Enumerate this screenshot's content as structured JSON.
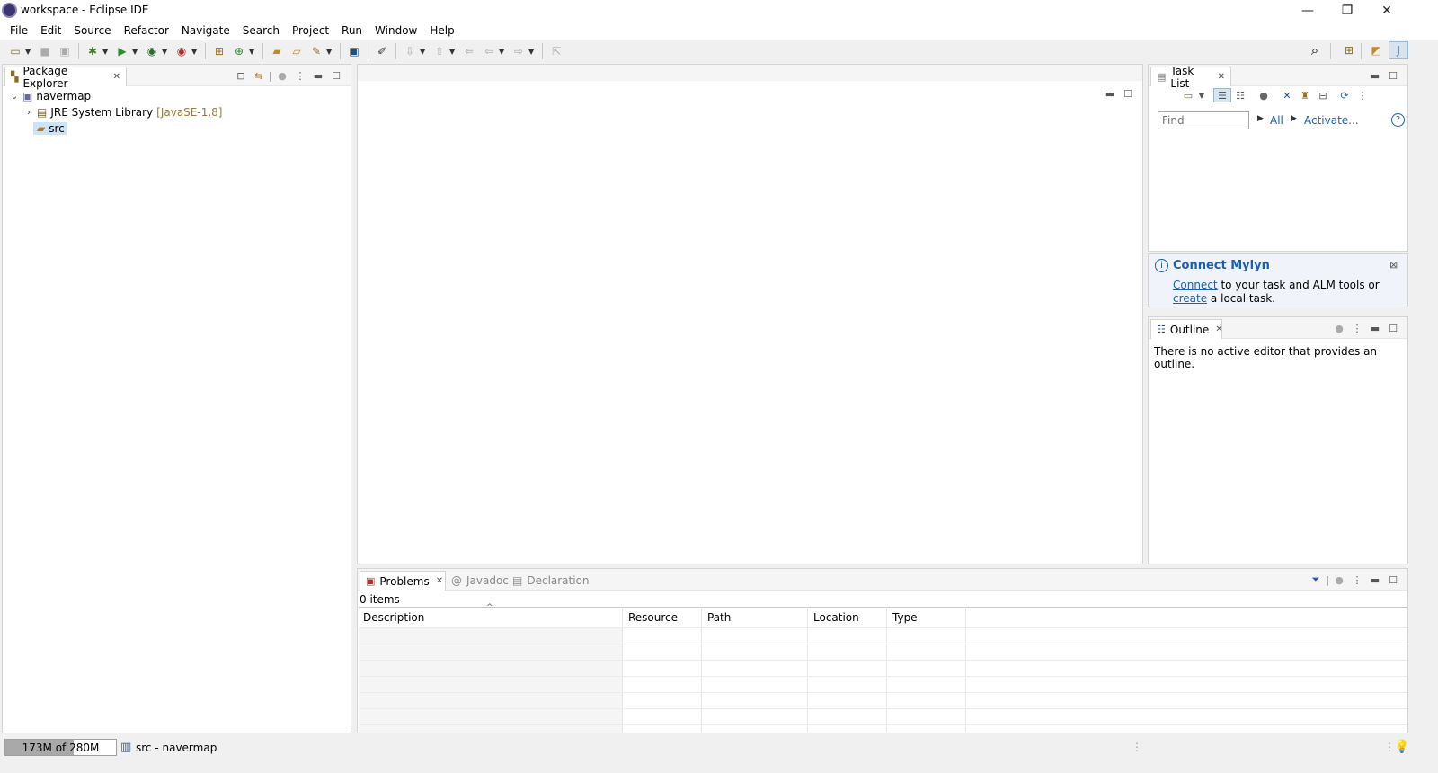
{
  "window": {
    "title": "workspace - Eclipse IDE",
    "controls": {
      "minimize": "—",
      "restore": "❐",
      "close": "✕"
    }
  },
  "menu": {
    "items": [
      {
        "label": "File"
      },
      {
        "label": "Edit"
      },
      {
        "label": "Source"
      },
      {
        "label": "Refactor"
      },
      {
        "label": "Navigate"
      },
      {
        "label": "Search"
      },
      {
        "label": "Project"
      },
      {
        "label": "Run"
      },
      {
        "label": "Window"
      },
      {
        "label": "Help"
      }
    ]
  },
  "package_explorer": {
    "tab_label": "Package Explorer",
    "tree": {
      "project": "navermap",
      "jre_label": "JRE System Library",
      "jre_decoration": "[JavaSE-1.8]",
      "src_label": "src"
    }
  },
  "task_list": {
    "tab_label": "Task List",
    "find_placeholder": "Find",
    "all_link": "All",
    "activate_link": "Activate...",
    "mylyn": {
      "title": "Connect Mylyn",
      "connect_link": "Connect",
      "text_middle": "to your task and ALM tools or",
      "create_link": "create",
      "text_a": "a",
      "text_end": "local task."
    }
  },
  "outline": {
    "tab_label": "Outline",
    "message": "There is no active editor that provides an outline."
  },
  "problems": {
    "tabs": {
      "problems": "Problems",
      "javadoc": "Javadoc",
      "declaration": "Declaration"
    },
    "count_text": "0 items",
    "columns": {
      "description": "Description",
      "resource": "Resource",
      "path": "Path",
      "location": "Location",
      "type": "Type"
    }
  },
  "status_bar": {
    "heap_text": "173M of 280M",
    "heap_used_fraction": 0.618,
    "selection": "src - navermap"
  },
  "colors": {
    "accent": "#1a5fb4",
    "selection": "#cce4f7"
  }
}
